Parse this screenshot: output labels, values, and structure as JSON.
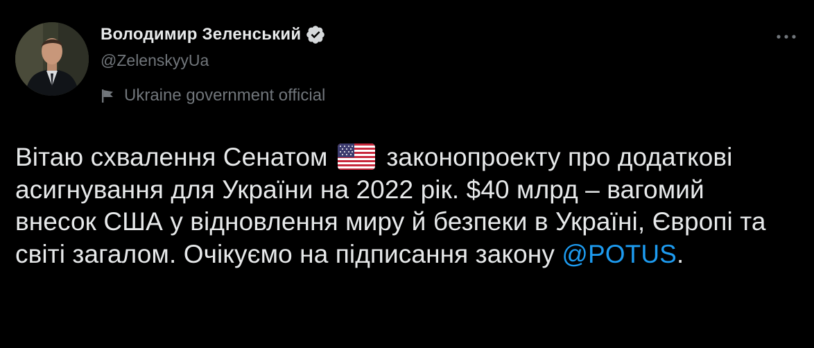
{
  "author": {
    "display_name": "Володимир Зеленський",
    "handle": "@ZelenskyyUa",
    "label": "Ukraine government official"
  },
  "tweet": {
    "text_before_flag": "Вітаю схвалення Сенатом",
    "text_after_flag": "законопроекту про додаткові асигнування для України на 2022 рік. $40 млрд – вагомий внесок США у відновлення миру й безпеки в Україні, Європі та світі загалом. Очікуємо на підписання закону",
    "mention": "@POTUS",
    "text_end": "."
  },
  "icons": {
    "verified": "verified-badge-icon",
    "label": "flag-icon",
    "flag_emoji": "us-flag-emoji",
    "more": "more-options-icon"
  },
  "colors": {
    "background": "#000000",
    "text_primary": "#e7e9ea",
    "text_secondary": "#71767b",
    "link": "#1d9bf0"
  }
}
